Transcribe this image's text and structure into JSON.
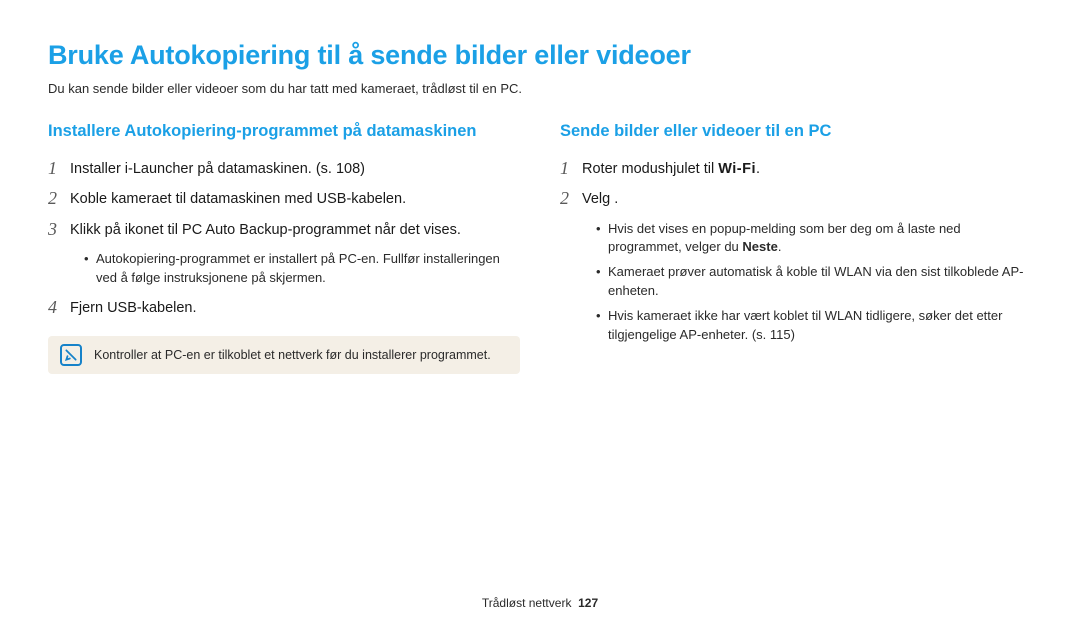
{
  "title": "Bruke Autokopiering til å sende bilder eller videoer",
  "intro": "Du kan sende bilder eller videoer som du har tatt med kameraet, trådløst til en PC.",
  "left": {
    "heading": "Installere Autokopiering-programmet på datamaskinen",
    "steps": [
      {
        "n": "1",
        "text": "Installer i-Launcher på datamaskinen. (s. 108)"
      },
      {
        "n": "2",
        "text": "Koble kameraet til datamaskinen med USB-kabelen."
      },
      {
        "n": "3",
        "text": "Klikk på ikonet til PC Auto Backup-programmet når det vises."
      },
      {
        "n": "4",
        "text": "Fjern USB-kabelen."
      }
    ],
    "sub3": "Autokopiering-programmet er installert på PC-en. Fullfør installeringen ved å følge instruksjonene på skjermen.",
    "note": "Kontroller at PC-en er tilkoblet et nettverk før du installerer programmet."
  },
  "right": {
    "heading": "Sende bilder eller videoer til en PC",
    "step1_pre": "Roter modushjulet til ",
    "wifi": "Wi-Fi",
    "step1_post": ".",
    "step2": "Velg     .",
    "subs": [
      {
        "text": "Hvis det vises en popup-melding som ber deg om å laste ned programmet, velger du ",
        "bold": "Neste",
        "tail": "."
      },
      {
        "text": "Kameraet prøver automatisk å koble til WLAN via den sist tilkoblede AP-enheten."
      },
      {
        "text": "Hvis kameraet ikke har vært koblet til WLAN tidligere, søker det etter tilgjengelige AP-enheter. (s. 115)"
      }
    ]
  },
  "footer": {
    "label": "Trådløst nettverk",
    "page": "127"
  }
}
